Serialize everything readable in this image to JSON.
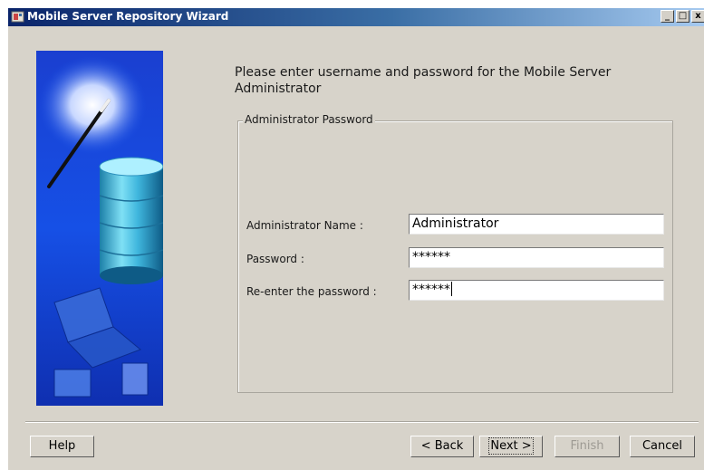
{
  "window": {
    "title": "Mobile Server Repository Wizard",
    "controls": {
      "minimize": "_",
      "maximize": "□",
      "close": "x"
    }
  },
  "intro_text": "Please enter username and password for the Mobile Server Administrator",
  "group": {
    "legend": "Administrator Password",
    "fields": {
      "name_label": "Administrator Name :",
      "name_value": "Administrator",
      "password_label": "Password :",
      "password_value": "******",
      "reenter_label": "Re-enter the password :",
      "reenter_value": "******"
    }
  },
  "buttons": {
    "help": "Help",
    "back": "< Back",
    "next": "Next >",
    "finish": "Finish",
    "cancel": "Cancel"
  },
  "icons": {
    "title_icon": "wizard-app-icon",
    "side_image": "wizard-side-illustration"
  },
  "colors": {
    "dialog_bg": "#d7d3ca",
    "titlebar_start": "#0a246a",
    "titlebar_end": "#a6caf0",
    "side_panel_blue": "#1446d8"
  }
}
